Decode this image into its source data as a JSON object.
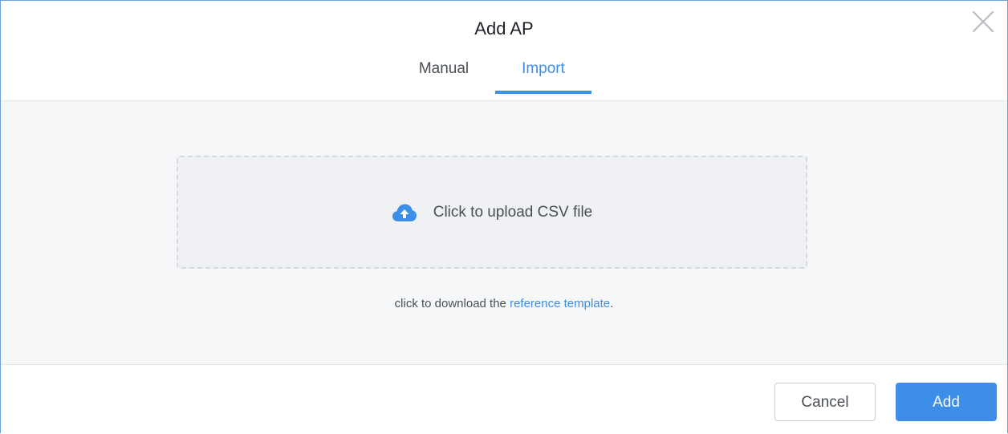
{
  "dialog": {
    "title": "Add AP"
  },
  "tabs": [
    {
      "label": "Manual",
      "active": false
    },
    {
      "label": "Import",
      "active": true
    }
  ],
  "upload": {
    "label": "Click to upload CSV file",
    "icon": "cloud-upload-icon"
  },
  "template": {
    "prefix": "click to download the ",
    "link_label": "reference template",
    "suffix": "."
  },
  "footer": {
    "cancel_label": "Cancel",
    "add_label": "Add"
  },
  "colors": {
    "accent": "#3d8ee8",
    "text": "#4a4f57",
    "border": "#6fa0d8"
  }
}
